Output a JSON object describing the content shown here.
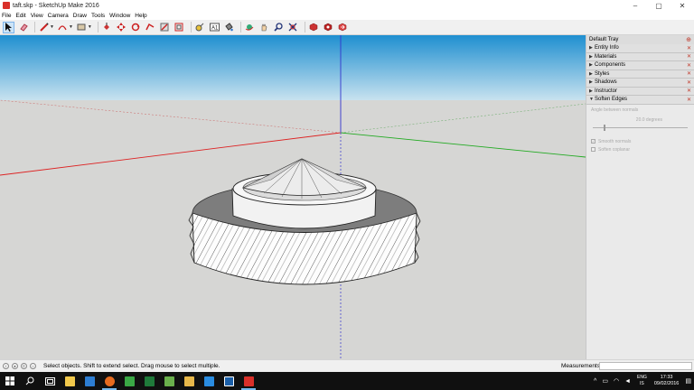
{
  "window": {
    "title": "taft.skp - SketchUp Make 2016",
    "minimize": "–",
    "maximize": "▢",
    "close": "✕"
  },
  "menu": [
    "File",
    "Edit",
    "View",
    "Camera",
    "Draw",
    "Tools",
    "Window",
    "Help"
  ],
  "toolbar": {
    "icons": [
      "select-arrow",
      "eraser",
      "pencil-line",
      "arc",
      "rectangle",
      "push-pull",
      "move",
      "rotate",
      "follow-me",
      "scale",
      "offset",
      "tape-measure",
      "text",
      "paint-bucket",
      "orbit",
      "pan",
      "zoom",
      "zoom-extents",
      "3d-warehouse",
      "extension-warehouse",
      "share-model"
    ]
  },
  "tray": {
    "title": "Default Tray",
    "panels": [
      {
        "label": "Entity Info",
        "open": false
      },
      {
        "label": "Materials",
        "open": false
      },
      {
        "label": "Components",
        "open": false
      },
      {
        "label": "Styles",
        "open": false
      },
      {
        "label": "Shadows",
        "open": false
      },
      {
        "label": "Instructor",
        "open": false
      },
      {
        "label": "Soften Edges",
        "open": true
      }
    ],
    "soften": {
      "angle_label": "Angle between normals",
      "degrees": "20.0  degrees",
      "slider_value": 0.11,
      "smooth_normals": "Smooth normals",
      "soften_coplanar": "Soften coplanar",
      "smooth_checked": true,
      "coplanar_checked": false
    }
  },
  "status": {
    "message": "Select objects. Shift to extend select. Drag mouse to select multiple.",
    "measurements_label": "Measurements",
    "measurements_value": ""
  },
  "taskbar": {
    "apps": [
      "windows-start",
      "search",
      "task-view",
      "file-explorer",
      "store",
      "firefox",
      "excel-like",
      "green-app",
      "evernote",
      "file-folder",
      "dropbox",
      "outlook-box",
      "sketchup"
    ],
    "lang": "ENG",
    "region": "IS",
    "time": "17:33",
    "date": "09/02/2016"
  },
  "colors": {
    "sky_top": "#1f8fd0",
    "sky_bottom": "#c8e2ef",
    "ground": "#d6d6d4",
    "axis_red": "#d22",
    "axis_green": "#2a2",
    "axis_blue": "#33c",
    "accent": "#0078d7"
  }
}
